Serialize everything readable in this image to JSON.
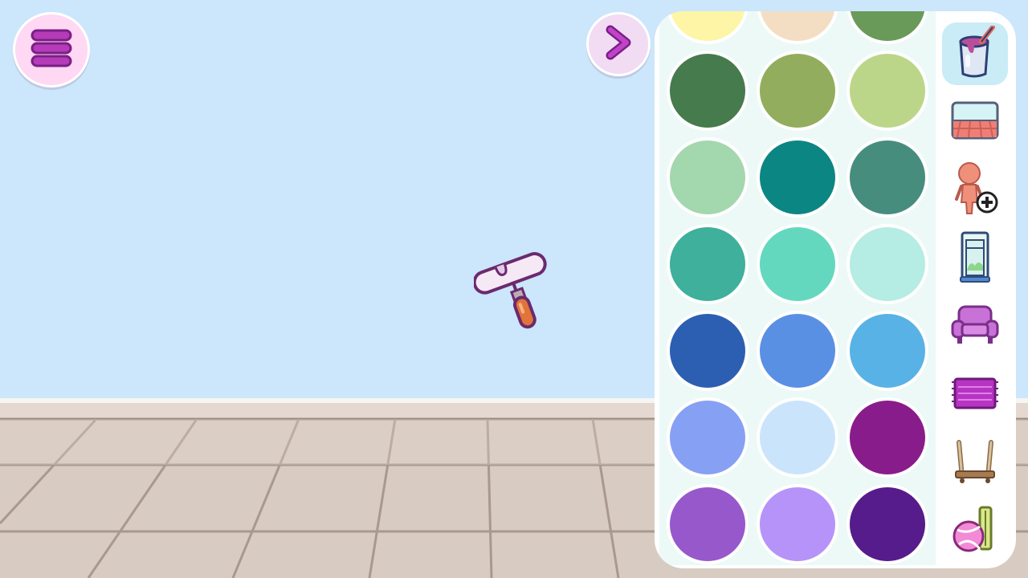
{
  "scene": {
    "wall_color": "#cce6fb",
    "floor_color": "#d8cbc2"
  },
  "toolbar": {
    "menu_icon": "hamburger-menu-icon",
    "next_icon": "chevron-right-icon"
  },
  "tool": {
    "name": "paint-roller-icon"
  },
  "palette": {
    "colors": [
      "#fef5a6",
      "#f4dec3",
      "#6a9a5a",
      "#467b4d",
      "#92ad5d",
      "#bcd689",
      "#a3d7ad",
      "#0b8683",
      "#468d7e",
      "#3eb09b",
      "#63d8bf",
      "#b5ece3",
      "#2c5fb2",
      "#5a90e3",
      "#58b2e5",
      "#86a0f4",
      "#cae5fb",
      "#891c8b",
      "#9758cb",
      "#b693f8",
      "#561c8b"
    ]
  },
  "categories": [
    {
      "id": "paint-bucket-icon",
      "active": true
    },
    {
      "id": "floor-wallpaper-icon",
      "active": false
    },
    {
      "id": "add-character-icon",
      "active": false
    },
    {
      "id": "window-icon",
      "active": false
    },
    {
      "id": "sofa-icon",
      "active": false
    },
    {
      "id": "rug-icon",
      "active": false
    },
    {
      "id": "shelf-icon",
      "active": false
    },
    {
      "id": "toys-icon",
      "active": false
    }
  ]
}
